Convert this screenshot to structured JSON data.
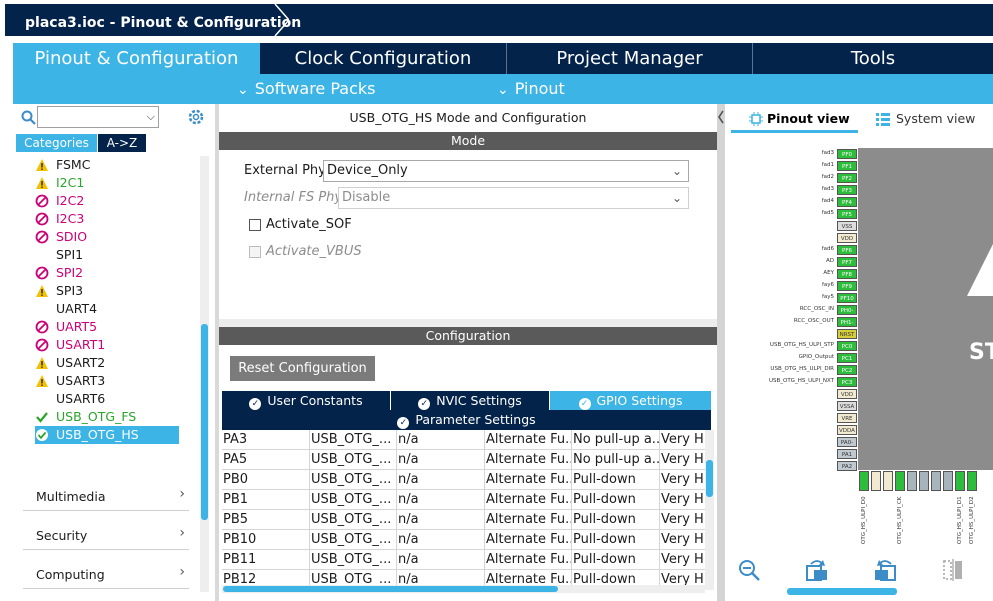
{
  "window": {
    "title": "placa3.ioc - Pinout & Configuration"
  },
  "nav": {
    "tabs": [
      {
        "label": "Pinout & Configuration",
        "active": true
      },
      {
        "label": "Clock Configuration"
      },
      {
        "label": "Project Manager"
      },
      {
        "label": "Tools"
      }
    ],
    "submenu": [
      {
        "label": "Software Packs"
      },
      {
        "label": "Pinout"
      }
    ]
  },
  "sidebar": {
    "search_value": "",
    "tab_categories": "Categories",
    "tab_az": "A->Z",
    "items": [
      {
        "label": "FSMC",
        "status": "warning"
      },
      {
        "label": "I2C1",
        "status": "warning",
        "color": "green"
      },
      {
        "label": "I2C2",
        "status": "blocked",
        "color": "pink"
      },
      {
        "label": "I2C3",
        "status": "blocked",
        "color": "pink"
      },
      {
        "label": "SDIO",
        "status": "blocked",
        "color": "pink"
      },
      {
        "label": "SPI1",
        "status": "none"
      },
      {
        "label": "SPI2",
        "status": "blocked",
        "color": "pink"
      },
      {
        "label": "SPI3",
        "status": "warning"
      },
      {
        "label": "UART4",
        "status": "none"
      },
      {
        "label": "UART5",
        "status": "blocked",
        "color": "pink"
      },
      {
        "label": "USART1",
        "status": "blocked",
        "color": "pink"
      },
      {
        "label": "USART2",
        "status": "warning"
      },
      {
        "label": "USART3",
        "status": "warning"
      },
      {
        "label": "USART6",
        "status": "none"
      },
      {
        "label": "USB_OTG_FS",
        "status": "ok",
        "color": "green"
      },
      {
        "label": "USB_OTG_HS",
        "status": "ok-selected",
        "selected": true
      }
    ],
    "groups": [
      {
        "label": "Multimedia"
      },
      {
        "label": "Security"
      },
      {
        "label": "Computing"
      }
    ]
  },
  "mode_panel": {
    "title": "USB_OTG_HS Mode and Configuration",
    "mode_header": "Mode",
    "external_phy_label": "External Phy",
    "external_phy_value": "Device_Only",
    "internal_fs_phy_label": "Internal FS Phy",
    "internal_fs_phy_value": "Disable",
    "activate_sof_label": "Activate_SOF",
    "activate_vbus_label": "Activate_VBUS"
  },
  "config_panel": {
    "header": "Configuration",
    "reset_label": "Reset Configuration",
    "tabs": [
      {
        "label": "User Constants"
      },
      {
        "label": "NVIC Settings"
      },
      {
        "label": "GPIO Settings",
        "active": true
      },
      {
        "label": "Parameter Settings"
      }
    ],
    "rows": [
      [
        "PA3",
        "USB_OTG_...",
        "n/a",
        "Alternate Fu...",
        "No pull-up a...",
        "Very Hig"
      ],
      [
        "PA5",
        "USB_OTG_...",
        "n/a",
        "Alternate Fu...",
        "No pull-up a...",
        "Very Hig"
      ],
      [
        "PB0",
        "USB_OTG_...",
        "n/a",
        "Alternate Fu...",
        "Pull-down",
        "Very Hig"
      ],
      [
        "PB1",
        "USB_OTG_...",
        "n/a",
        "Alternate Fu...",
        "Pull-down",
        "Very Hig"
      ],
      [
        "PB5",
        "USB_OTG_...",
        "n/a",
        "Alternate Fu...",
        "Pull-down",
        "Very Hig"
      ],
      [
        "PB10",
        "USB_OTG_...",
        "n/a",
        "Alternate Fu...",
        "Pull-down",
        "Very Hig"
      ],
      [
        "PB11",
        "USB_OTG_...",
        "n/a",
        "Alternate Fu...",
        "Pull-down",
        "Very Hig"
      ],
      [
        "PB12",
        "USB_OTG_...",
        "n/a",
        "Alternate Fu...",
        "Pull-down",
        "Very Hig"
      ]
    ]
  },
  "pinout_panel": {
    "tab_pinout": "Pinout view",
    "tab_system": "System view",
    "chip_text": "ST",
    "left_pins": [
      {
        "label": "fad3",
        "pin": "PF0",
        "color": "green"
      },
      {
        "label": "fad1",
        "pin": "PF1",
        "color": "green"
      },
      {
        "label": "fad2",
        "pin": "PF2",
        "color": "green"
      },
      {
        "label": "fad3",
        "pin": "PF3",
        "color": "green"
      },
      {
        "label": "fad4",
        "pin": "PF4",
        "color": "green"
      },
      {
        "label": "fad5",
        "pin": "PF5",
        "color": "green"
      },
      {
        "label": "",
        "pin": "VSS",
        "color": "gray"
      },
      {
        "label": "",
        "pin": "VDD",
        "color": "cream"
      },
      {
        "label": "fad6",
        "pin": "PF6",
        "color": "green"
      },
      {
        "label": "AD",
        "pin": "PF7",
        "color": "green"
      },
      {
        "label": "AEY",
        "pin": "PF8",
        "color": "green"
      },
      {
        "label": "fay6",
        "pin": "PF9",
        "color": "green"
      },
      {
        "label": "fay5",
        "pin": "PF10",
        "color": "green"
      },
      {
        "label": "RCC_OSC_IN",
        "pin": "PH0-",
        "color": "green"
      },
      {
        "label": "RCC_OSC_OUT",
        "pin": "PH1-",
        "color": "green"
      },
      {
        "label": "",
        "pin": "NRST",
        "color": "yellow"
      },
      {
        "label": "USB_OTG_HS_ULPI_STP",
        "pin": "PC0",
        "color": "green"
      },
      {
        "label": "GPIO_Output",
        "pin": "PC1",
        "color": "green"
      },
      {
        "label": "USB_OTG_HS_ULPI_DIR",
        "pin": "PC2",
        "color": "green"
      },
      {
        "label": "USB_OTG_HS_ULPI_NXT",
        "pin": "PC3",
        "color": "green"
      },
      {
        "label": "",
        "pin": "VDD",
        "color": "cream"
      },
      {
        "label": "",
        "pin": "VSSA",
        "color": "gray"
      },
      {
        "label": "",
        "pin": "VRE",
        "color": "cream"
      },
      {
        "label": "",
        "pin": "VDDA",
        "color": "cream"
      },
      {
        "label": "",
        "pin": "PA0-",
        "color": "lightgray"
      },
      {
        "label": "",
        "pin": "PA1",
        "color": "lightgray"
      },
      {
        "label": "",
        "pin": "PA2",
        "color": "lightgray"
      }
    ],
    "bottom_pins": [
      {
        "label": "OTG_HS_ULPI_D0",
        "color": "green"
      },
      {
        "label": "",
        "color": "cream"
      },
      {
        "label": "",
        "color": "cream"
      },
      {
        "label": "OTG_HS_ULPI_CK",
        "color": "green"
      },
      {
        "label": "",
        "color": "gray"
      },
      {
        "label": "",
        "color": "gray"
      },
      {
        "label": "",
        "color": "gray"
      },
      {
        "label": "",
        "color": "gray"
      },
      {
        "label": "OTG_HS_ULPI_D1",
        "color": "green"
      },
      {
        "label": "OTG_HS_ULPI_D2",
        "color": "green"
      }
    ]
  },
  "colors": {
    "dark": "#03234b",
    "accent": "#3cb4e6",
    "pin_green": "#2ebc3c"
  }
}
